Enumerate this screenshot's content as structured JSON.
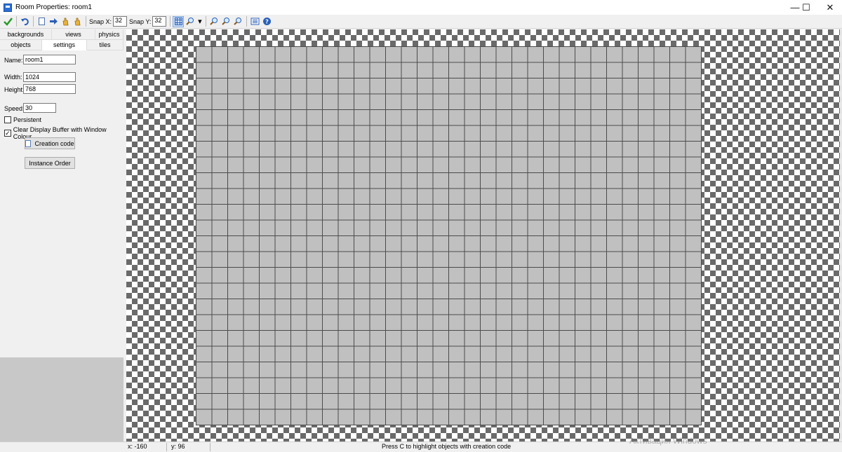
{
  "window": {
    "title": "Room Properties: room1",
    "minimize": "—",
    "maximize": "☐",
    "close": "✕"
  },
  "toolbar": {
    "icons": [
      "ok-check-icon",
      "undo-icon",
      "new-document-icon",
      "arrow-right-icon",
      "hand-icon",
      "hand-icon-2",
      "grid-icon",
      "zoom-icon",
      "zoom-in-icon",
      "zoom-reset-icon",
      "zoom-out-icon",
      "settings-list-icon",
      "help-icon"
    ],
    "snap_x_label": "Snap X:",
    "snap_x_value": "32",
    "snap_y_label": "Snap Y:",
    "snap_y_value": "32",
    "dropdown_arrow": "▾"
  },
  "tabs": {
    "row1": [
      "backgrounds",
      "views",
      "physics"
    ],
    "row2": [
      "objects",
      "settings",
      "tiles"
    ],
    "active": "settings"
  },
  "settings": {
    "name_label": "Name:",
    "name_value": "room1",
    "width_label": "Width:",
    "width_value": "1024",
    "height_label": "Height:",
    "height_value": "768",
    "speed_label": "Speed:",
    "speed_value": "30",
    "persistent_label": "Persistent",
    "persistent_checked": false,
    "clear_label": "Clear Display Buffer with Window Colour",
    "clear_checked": true,
    "creation_code_button": "Creation code",
    "instance_order_button": "Instance Order"
  },
  "status": {
    "x": "x: -160",
    "y": "y: 96",
    "hint": "Press C to highlight objects with creation code"
  },
  "watermark": "Активация Windows",
  "colors": {
    "accent": "#2a6fd6",
    "room_fill": "#c0c0c0",
    "grid_line": "#4b4b4b",
    "checker_dark": "#6a6a6a",
    "panel_bg": "#f0f0f0"
  }
}
